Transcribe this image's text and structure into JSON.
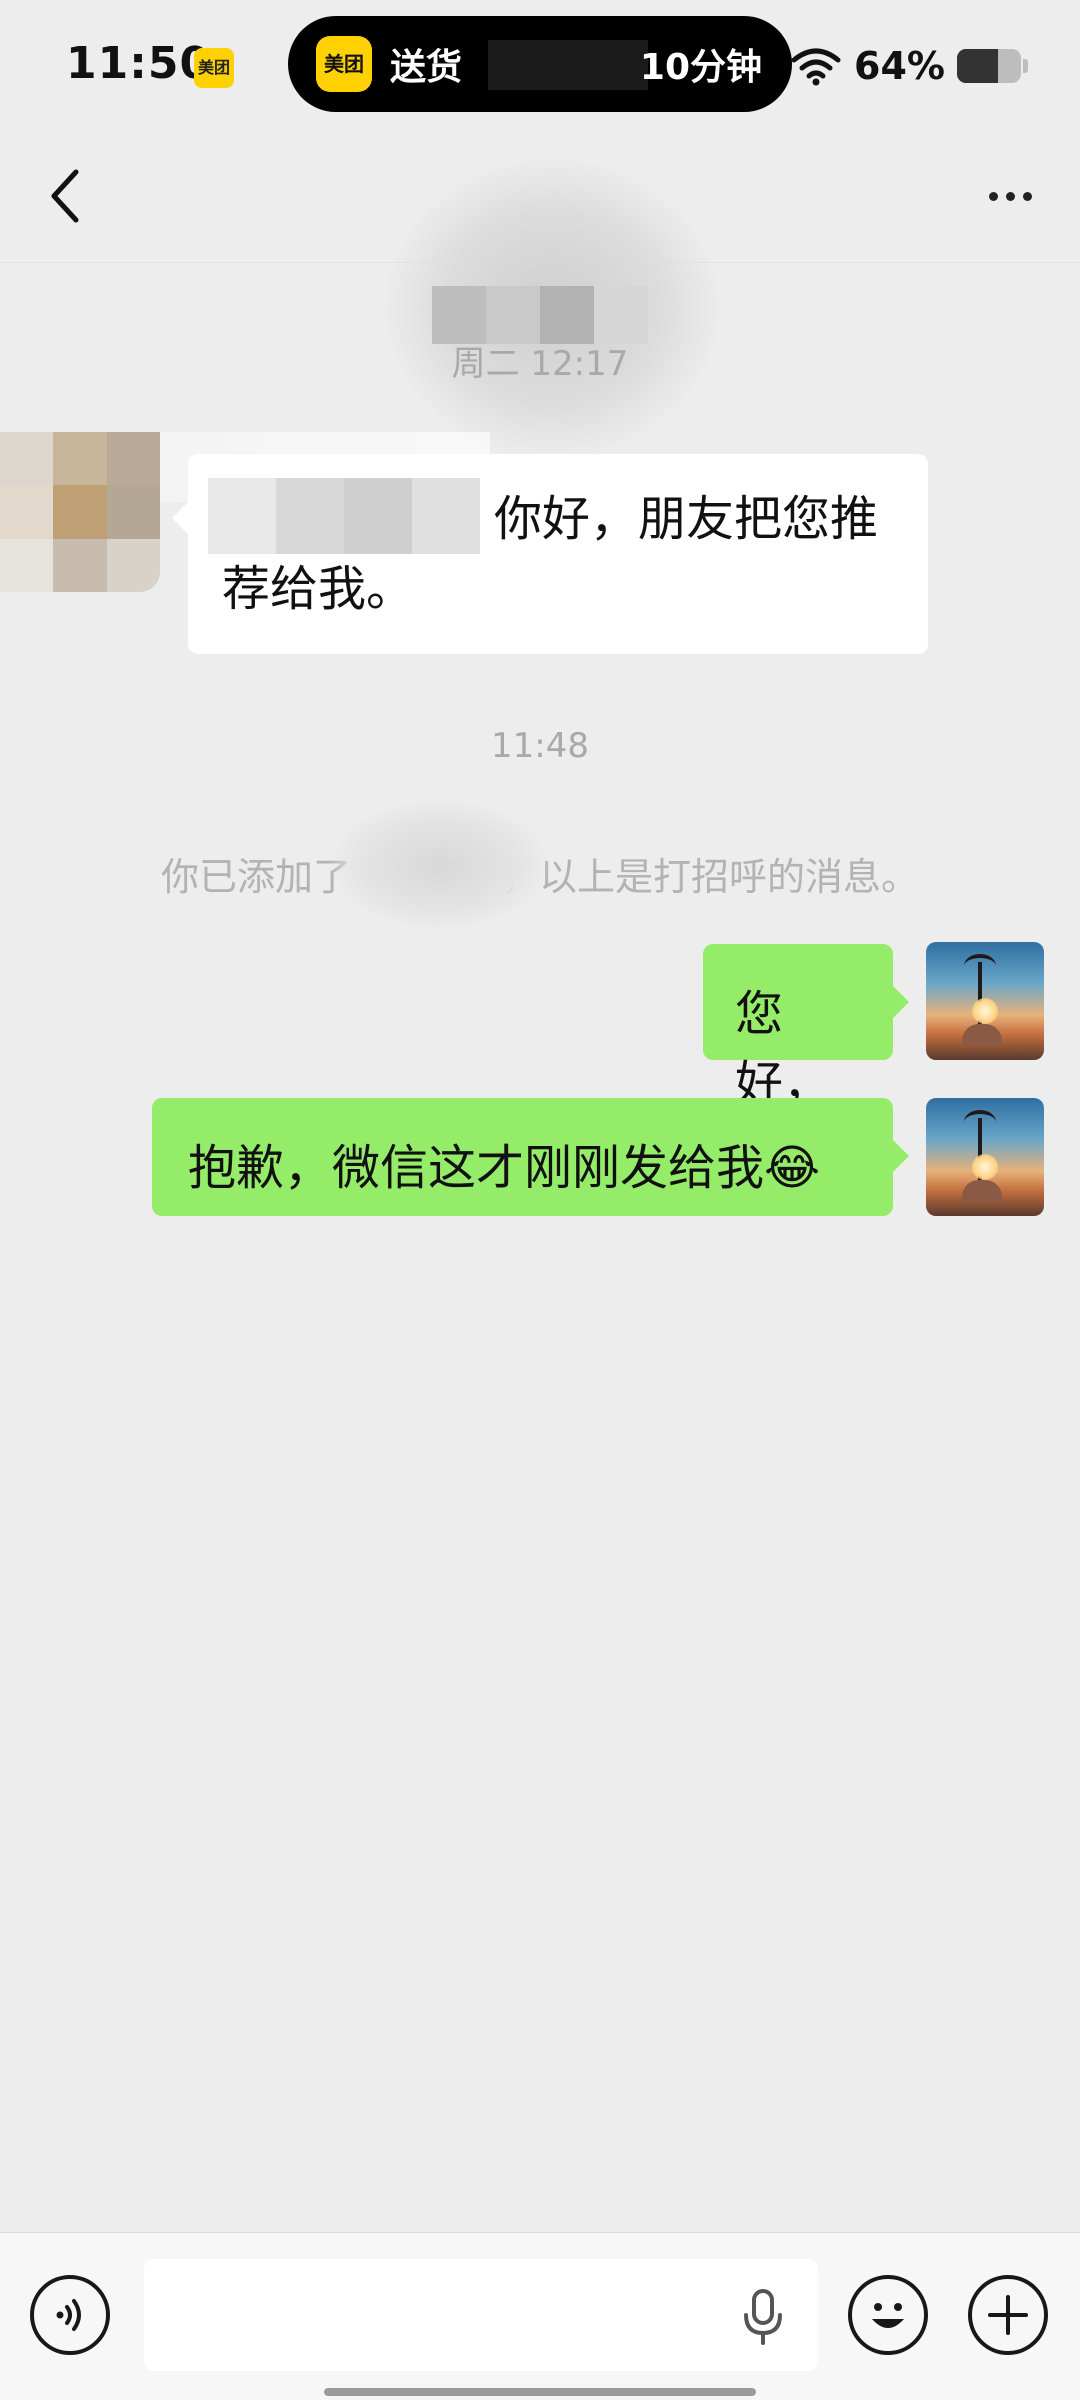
{
  "status_bar": {
    "time": "11:50",
    "app_badge": "美团",
    "island_badge": "美团",
    "island_text_left": "送货",
    "island_text_right": "10分钟",
    "battery_percent": "64%",
    "battery_level": 0.64,
    "wifi_icon": "wifi-icon"
  },
  "nav": {
    "back_icon": "chevron-left-icon",
    "more_icon": "more-dots-icon"
  },
  "messages": {
    "timestamp_1": "周二 12:17",
    "incoming_1": "你好，朋友把您推荐给我。",
    "timestamp_2": "11:48",
    "system_prefix": "你已添加了",
    "system_suffix": "，以上是打招呼的消息。",
    "outgoing_1": "您好，",
    "outgoing_2": "抱歉，微信这才刚刚发给我",
    "outgoing_2_emoji": "😂"
  },
  "input_bar": {
    "voice_icon": "voice-wave-icon",
    "mic_icon": "microphone-icon",
    "emoji_icon": "emoji-smile-icon",
    "plus_icon": "plus-icon",
    "input_value": ""
  },
  "colors": {
    "background": "#ededed",
    "outgoing_bubble": "#95ec69",
    "incoming_bubble": "#ffffff",
    "meituan_yellow": "#ffd100"
  }
}
